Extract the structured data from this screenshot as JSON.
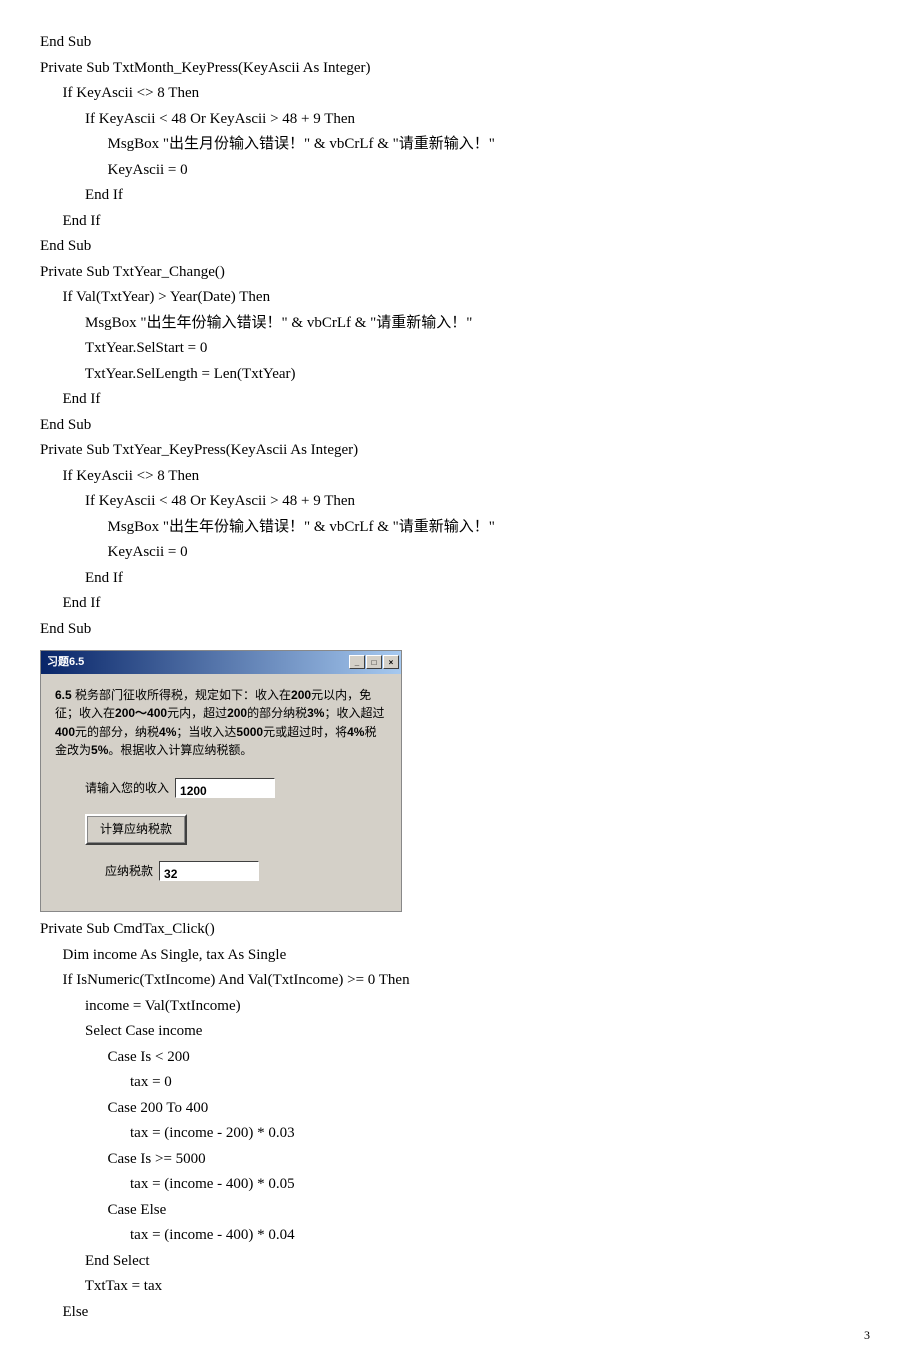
{
  "code1": "End Sub\nPrivate Sub TxtMonth_KeyPress(KeyAscii As Integer)\n      If KeyAscii <> 8 Then\n            If KeyAscii < 48 Or KeyAscii > 48 + 9 Then\n                  MsgBox \"出生月份输入错误！\" & vbCrLf & \"请重新输入！\"\n                  KeyAscii = 0\n            End If\n      End If\nEnd Sub\nPrivate Sub TxtYear_Change()\n      If Val(TxtYear) > Year(Date) Then\n            MsgBox \"出生年份输入错误！\" & vbCrLf & \"请重新输入！\"\n            TxtYear.SelStart = 0\n            TxtYear.SelLength = Len(TxtYear)\n      End If\nEnd Sub\nPrivate Sub TxtYear_KeyPress(KeyAscii As Integer)\n      If KeyAscii <> 8 Then\n            If KeyAscii < 48 Or KeyAscii > 48 + 9 Then\n                  MsgBox \"出生年份输入错误！\" & vbCrLf & \"请重新输入！\"\n                  KeyAscii = 0\n            End If\n      End If\nEnd Sub",
  "dialog": {
    "title": "习题6.5",
    "desc_parts": {
      "p1": "6.5",
      "p2": " 税务部门征收所得税，规定如下：收入在",
      "p3": "200",
      "p4": "元以内，免征；收入在",
      "p5": "200～400",
      "p6": "元内，超过",
      "p7": "200",
      "p8": "的部分纳税",
      "p9": "3%",
      "p10": "；收入超过",
      "p11": "400",
      "p12": "元的部分，纳税",
      "p13": "4%",
      "p14": "；当收入达",
      "p15": "5000",
      "p16": "元或超过时，将",
      "p17": "4%",
      "p18": "税金改为",
      "p19": "5%",
      "p20": "。根据收入计算应纳税额。"
    },
    "income_label": "请输入您的收入",
    "income_value": "1200",
    "calc_button": "计算应纳税款",
    "tax_label": "应纳税款",
    "tax_value": "32"
  },
  "code2": "Private Sub CmdTax_Click()\n      Dim income As Single, tax As Single\n      If IsNumeric(TxtIncome) And Val(TxtIncome) >= 0 Then\n            income = Val(TxtIncome)\n            Select Case income\n                  Case Is < 200\n                        tax = 0\n                  Case 200 To 400\n                        tax = (income - 200) * 0.03\n                  Case Is >= 5000\n                        tax = (income - 400) * 0.05\n                  Case Else\n                        tax = (income - 400) * 0.04\n            End Select\n            TxtTax = tax\n      Else",
  "page_number": "3"
}
